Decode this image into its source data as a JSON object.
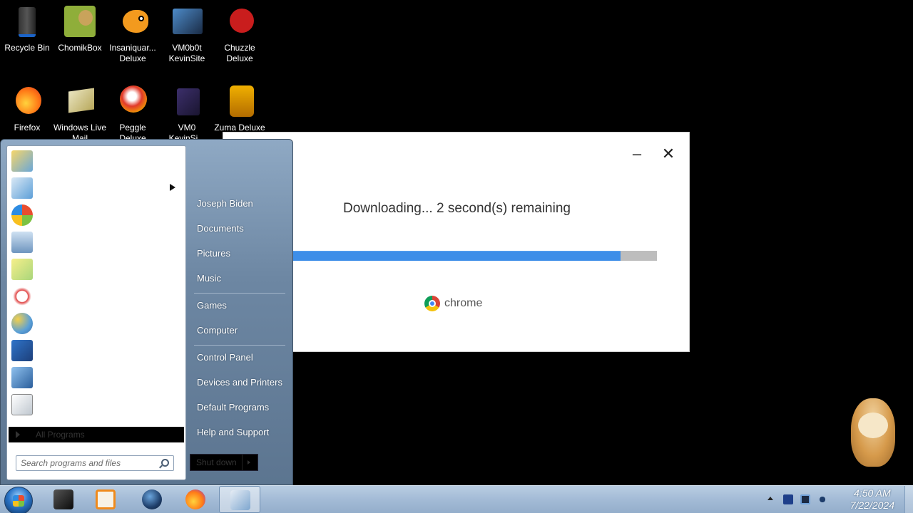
{
  "desktop": {
    "icons": [
      {
        "label": "Recycle Bin",
        "icon": "recycle-bin-icon"
      },
      {
        "label": "ChomikBox",
        "icon": "chomikbox-icon"
      },
      {
        "label": "Insaniquar... Deluxe",
        "icon": "insaniquarium-icon"
      },
      {
        "label": "VM0b0t KevinSite",
        "icon": "vm0b0t-icon"
      },
      {
        "label": "Chuzzle Deluxe",
        "icon": "chuzzle-icon"
      },
      {
        "label": "Firefox",
        "icon": "firefox-icon"
      },
      {
        "label": "Windows Live Mail",
        "icon": "live-mail-icon"
      },
      {
        "label": "Peggle Deluxe",
        "icon": "peggle-icon"
      },
      {
        "label": "VM0 KevinSi...",
        "icon": "vm0-icon"
      },
      {
        "label": "Zuma Deluxe",
        "icon": "zuma-icon"
      }
    ]
  },
  "installer": {
    "minimize_label": "–",
    "close_label": "✕",
    "status": "Downloading... 2 second(s) remaining",
    "progress": 0.9,
    "brand": "chrome",
    "colors": {
      "progress_fill": "#3d8ee8",
      "progress_track": "#bdbdbd"
    }
  },
  "start_menu": {
    "user_name": "Joseph Biden",
    "right_items": [
      "Documents",
      "Pictures",
      "Music",
      "Games",
      "Computer",
      "Control Panel",
      "Devices and Printers",
      "Default Programs",
      "Help and Support"
    ],
    "all_programs": "All Programs",
    "search_placeholder": "Search programs and files",
    "shutdown_label": "Shut down"
  },
  "taskbar": {
    "time": "4:50 AM",
    "date": "7/22/2024"
  }
}
